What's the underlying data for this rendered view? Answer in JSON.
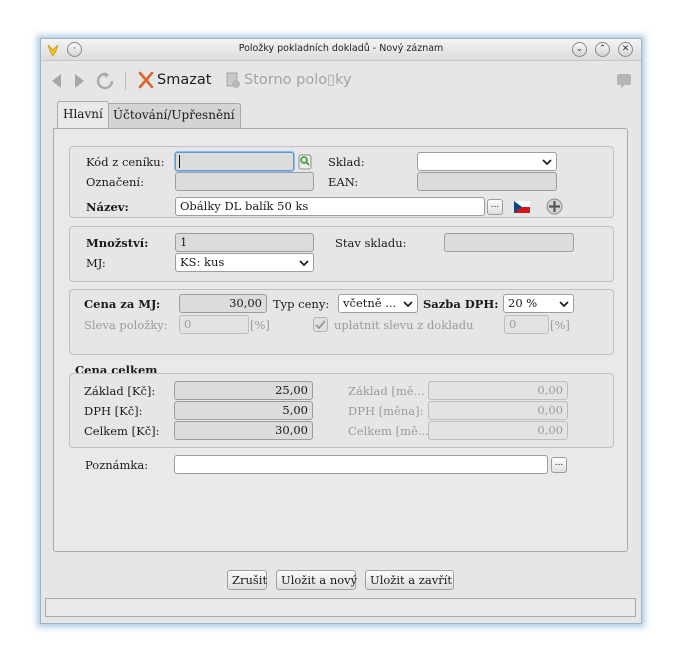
{
  "window": {
    "title": "Položky pokladních dokladů - Nový záznam"
  },
  "toolbar": {
    "delete_label": "Smazat",
    "storno_label": "Storno polo▯ky"
  },
  "tabs": [
    {
      "label": "Hlavní"
    },
    {
      "label": "Účtování/Upřesnění"
    }
  ],
  "item": {
    "kod_label": "Kód z ceníku:",
    "kod_value": "",
    "sklad_label": "Sklad:",
    "sklad_value": "",
    "oznaceni_label": "Označení:",
    "oznaceni_value": "",
    "ean_label": "EAN:",
    "ean_value": "",
    "nazev_label": "Název:",
    "nazev_value": "Obálky DL balík 50 ks",
    "dots": "..."
  },
  "quantity": {
    "mnozstvi_label": "Množství:",
    "mnozstvi_value": "1",
    "stav_label": "Stav skladu:",
    "stav_value": "",
    "mj_label": "MJ:",
    "mj_value": "KS: kus"
  },
  "price": {
    "cena_label": "Cena za MJ:",
    "cena_value": "30,00",
    "typ_label": "Typ ceny:",
    "typ_value": "včetně ...",
    "sazba_label": "Sazba DPH:",
    "sazba_value": "20 %",
    "sleva_label": "Sleva položky:",
    "sleva_value": "0",
    "sleva_unit": "[%]",
    "uplatnit_label": "uplatnit slevu z dokladu",
    "doklad_value": "0",
    "doklad_unit": "[%]"
  },
  "totals": {
    "group_title": "Cena celkem",
    "zaklad_label": "Základ [Kč]:",
    "zaklad_value": "25,00",
    "dph_label": "DPH [Kč]:",
    "dph_value": "5,00",
    "celkem_label": "Celkem [Kč]:",
    "celkem_value": "30,00",
    "zaklad_mena_label": "Základ [mě...",
    "zaklad_mena_value": "0,00",
    "dph_mena_label": "DPH [měna]:",
    "dph_mena_value": "0,00",
    "celkem_mena_label": "Celkem [mě...",
    "celkem_mena_value": "0,00"
  },
  "note": {
    "label": "Poznámka:",
    "value": "",
    "dots": "..."
  },
  "buttons": {
    "cancel": "Zrušit",
    "save_new": "Uložit a nový",
    "save_close": "Uložit a zavřít"
  },
  "status": {
    "text": ""
  },
  "colors": {
    "accent_focus": "#5d9ad6",
    "glow": "#6ea0c8",
    "delete_icon": "#e0622c"
  }
}
